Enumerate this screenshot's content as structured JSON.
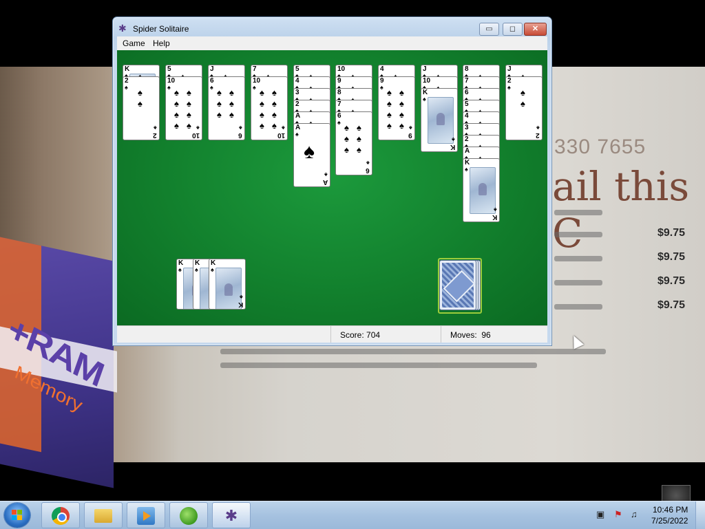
{
  "window": {
    "title": "Spider Solitaire",
    "menu": [
      "Game",
      "Help"
    ],
    "controls": {
      "minimize": "▭",
      "maximize": "◻",
      "close": "✕"
    }
  },
  "board": {
    "tableau": [
      [
        {
          "face": "down"
        },
        {
          "rank": "K",
          "suit": "♠",
          "face": "up",
          "face_card": true
        },
        {
          "rank": "2",
          "suit": "♠",
          "face": "up"
        }
      ],
      [
        {
          "rank": "5",
          "suit": "♠",
          "face": "up"
        },
        {
          "rank": "10",
          "suit": "♠",
          "face": "up"
        }
      ],
      [
        {
          "face": "down"
        },
        {
          "rank": "J",
          "suit": "♠",
          "face": "up"
        },
        {
          "rank": "6",
          "suit": "♠",
          "face": "up"
        }
      ],
      [
        {
          "rank": "7",
          "suit": "♠",
          "face": "up"
        },
        {
          "rank": "10",
          "suit": "♠",
          "face": "up"
        }
      ],
      [
        {
          "rank": "5",
          "suit": "♠"
        },
        {
          "rank": "4",
          "suit": "♠"
        },
        {
          "rank": "3",
          "suit": "♠"
        },
        {
          "rank": "2",
          "suit": "♠"
        },
        {
          "rank": "A",
          "suit": "♠"
        },
        {
          "rank": "A",
          "suit": "♠",
          "big": true
        }
      ],
      [
        {
          "rank": "10",
          "suit": "♠"
        },
        {
          "rank": "9",
          "suit": "♠"
        },
        {
          "rank": "8",
          "suit": "♠"
        },
        {
          "rank": "7",
          "suit": "♠"
        },
        {
          "rank": "6",
          "suit": "♠"
        }
      ],
      [
        {
          "rank": "4",
          "suit": "♠"
        },
        {
          "rank": "9",
          "suit": "♠"
        }
      ],
      [
        {
          "rank": "J",
          "suit": "♠"
        },
        {
          "rank": "10",
          "suit": "♠"
        },
        {
          "rank": "K",
          "suit": "♠",
          "face_card": true
        }
      ],
      [
        {
          "rank": "8",
          "suit": "♠"
        },
        {
          "rank": "7",
          "suit": "♠"
        },
        {
          "rank": "6",
          "suit": "♠"
        },
        {
          "rank": "5",
          "suit": "♠"
        },
        {
          "rank": "4",
          "suit": "♠"
        },
        {
          "rank": "3",
          "suit": "♠"
        },
        {
          "rank": "2",
          "suit": "♠"
        },
        {
          "rank": "A",
          "suit": "♠"
        },
        {
          "rank": "K",
          "suit": "♠",
          "face_card": true
        }
      ],
      [
        {
          "face": "down"
        },
        {
          "rank": "J",
          "suit": "♠",
          "face": "up"
        },
        {
          "rank": "2",
          "suit": "♠",
          "face": "up"
        }
      ]
    ],
    "completed_piles": [
      {
        "rank": "K",
        "suit": "♠"
      },
      {
        "rank": "K",
        "suit": "♠"
      },
      {
        "rank": "K",
        "suit": "♠"
      }
    ],
    "stock_piles": 3
  },
  "status": {
    "score_label": "Score: 704",
    "moves_label": "Moves:",
    "moves_value": "96"
  },
  "taskbar": {
    "apps": [
      {
        "name": "chrome",
        "icon": "chrome-icon"
      },
      {
        "name": "explorer",
        "icon": "folder-icon"
      },
      {
        "name": "media-player",
        "icon": "media-icon"
      },
      {
        "name": "media-center",
        "icon": "wmc-icon"
      },
      {
        "name": "spider-solitaire",
        "icon": "spider-icon",
        "active": true
      }
    ],
    "clock_time": "10:46 PM",
    "clock_date": "7/25/2022"
  },
  "desktop_photo": {
    "phone_text": "330 7655",
    "heading_text": "ail this C",
    "prices": [
      "$9.75",
      "$9.75",
      "$9.75",
      "$9.75"
    ],
    "box_brand": "+RAM",
    "box_sub": "Memory"
  }
}
